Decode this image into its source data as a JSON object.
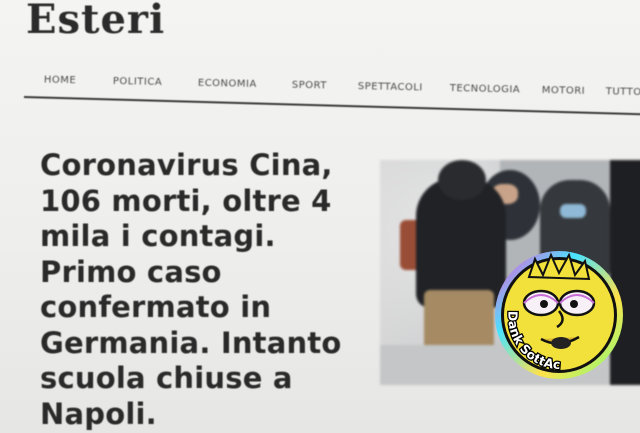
{
  "section": {
    "title": "Esteri"
  },
  "nav": {
    "items": [
      {
        "label": "HOME"
      },
      {
        "label": "POLITICA"
      },
      {
        "label": "ECONOMIA"
      },
      {
        "label": "SPORT"
      },
      {
        "label": "SPETTACOLI"
      },
      {
        "label": "TECNOLOGIA"
      },
      {
        "label": "MOTORI"
      },
      {
        "label": "TUTTO"
      }
    ]
  },
  "article": {
    "headline_lines": [
      "Coronavirus Cina,",
      "106 morti, oltre 4",
      "mila i contagi.",
      "Primo caso",
      "confermato in",
      "Germania. Intanto",
      "scuola chiuse a",
      "Napoli."
    ]
  },
  "watermark": {
    "text": "Dank SottAceto"
  },
  "colors": {
    "page_bg": "#eeeeec",
    "text": "#2a2a2a",
    "rule": "#3a3a3a",
    "sticker_yellow": "#f2e13a"
  }
}
